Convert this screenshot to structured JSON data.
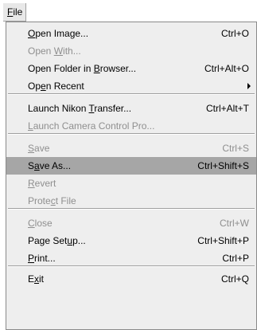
{
  "menubar": {
    "file_label": "File",
    "file_mnemonic": "F"
  },
  "items": [
    {
      "label": "Open Image...",
      "shortcut": "Ctrl+O",
      "mnemonic_index": 0,
      "disabled": false,
      "selected": false
    },
    {
      "label": "Open With...",
      "shortcut": "",
      "mnemonic_index": 5,
      "disabled": true,
      "selected": false
    },
    {
      "label": "Open Folder in Browser...",
      "shortcut": "Ctrl+Alt+O",
      "mnemonic_index": 15,
      "disabled": false,
      "selected": false
    },
    {
      "label": "Open Recent",
      "shortcut": "",
      "mnemonic_index": 2,
      "disabled": false,
      "selected": false,
      "submenu": true
    },
    {
      "label": "Launch Nikon Transfer...",
      "shortcut": "Ctrl+Alt+T",
      "mnemonic_index": 13,
      "disabled": false,
      "selected": false
    },
    {
      "label": "Launch Camera Control Pro...",
      "shortcut": "",
      "mnemonic_index": 0,
      "disabled": true,
      "selected": false
    },
    {
      "label": "Save",
      "shortcut": "Ctrl+S",
      "mnemonic_index": 0,
      "disabled": true,
      "selected": false
    },
    {
      "label": "Save As...",
      "shortcut": "Ctrl+Shift+S",
      "mnemonic_index": 1,
      "disabled": false,
      "selected": true
    },
    {
      "label": "Revert",
      "shortcut": "",
      "mnemonic_index": 0,
      "disabled": true,
      "selected": false
    },
    {
      "label": "Protect File",
      "shortcut": "",
      "mnemonic_index": 5,
      "disabled": true,
      "selected": false
    },
    {
      "label": "Close",
      "shortcut": "Ctrl+W",
      "mnemonic_index": 0,
      "disabled": true,
      "selected": false
    },
    {
      "label": "Page Setup...",
      "shortcut": "Ctrl+Shift+P",
      "mnemonic_index": 8,
      "disabled": false,
      "selected": false
    },
    {
      "label": "Print...",
      "shortcut": "Ctrl+P",
      "mnemonic_index": 0,
      "disabled": false,
      "selected": false
    },
    {
      "label": "Exit",
      "shortcut": "Ctrl+Q",
      "mnemonic_index": 1,
      "disabled": false,
      "selected": false
    }
  ],
  "colors": {
    "menu_bg": "#eeeeee",
    "selected_bg": "#a6a6a6",
    "disabled_text": "#8f8f8f"
  }
}
